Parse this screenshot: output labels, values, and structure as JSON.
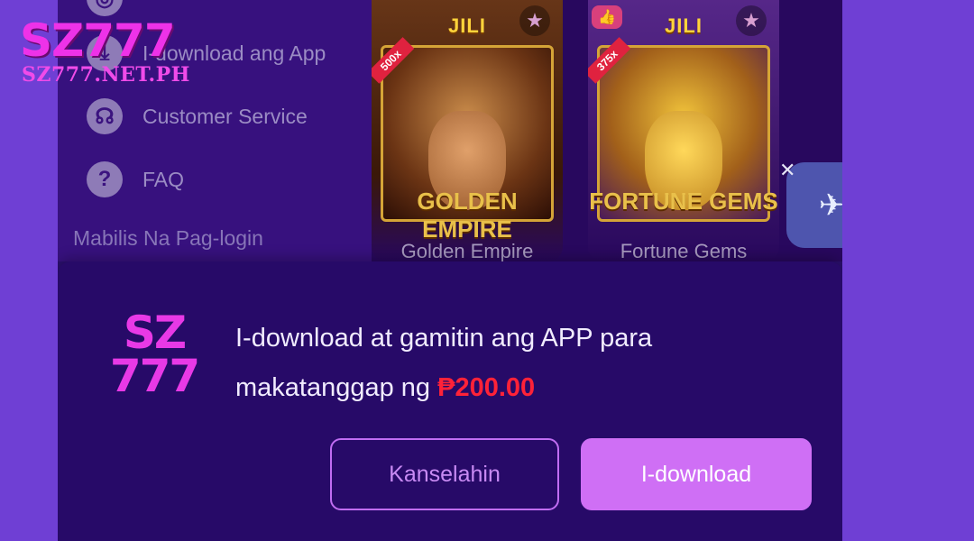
{
  "watermark": {
    "brand": "SZ777",
    "url": "SZ777.NET.PH"
  },
  "sidebar": {
    "items": [
      {
        "icon": "download-icon",
        "label": "I-download ang App"
      },
      {
        "icon": "headset-icon",
        "label": "Customer Service"
      },
      {
        "icon": "question-icon",
        "label": "FAQ"
      }
    ],
    "quick_login": "Mabilis Na Pag-login"
  },
  "games": [
    {
      "provider": "JILI",
      "art_title": "GOLDEN EMPIRE",
      "name": "Golden Empire",
      "multiplier": "500x"
    },
    {
      "provider": "JILI",
      "art_title": "FORTUNE GEMS",
      "name": "Fortune Gems",
      "multiplier": "375x"
    }
  ],
  "modal": {
    "logo_line1": "SZ",
    "logo_line2": "777",
    "message_part1": "I-download at gamitin ang APP para makatanggap ng",
    "amount": "₱200.00",
    "cancel_label": "Kanselahin",
    "download_label": "I-download"
  },
  "colors": {
    "page_bg": "#6f3fd4",
    "panel_bg": "#270a68",
    "brand_magenta": "#ee32e8",
    "amount_red": "#ff2238",
    "download_button": "#cf6ff5"
  }
}
